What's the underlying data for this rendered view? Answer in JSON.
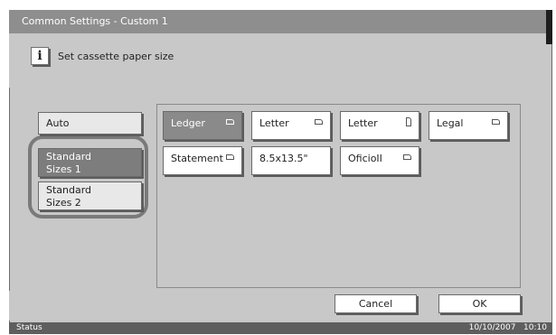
{
  "window": {
    "title": "Common Settings - Custom 1"
  },
  "info": {
    "icon": "info-icon",
    "glyph": "i",
    "message": "Set cassette paper size"
  },
  "size_modes": [
    {
      "label": "Auto",
      "selected": false
    },
    {
      "label": "Standard\nSizes 1",
      "selected": true
    },
    {
      "label": "Standard\nSizes 2",
      "selected": false
    }
  ],
  "paper_sizes": [
    {
      "label": "Ledger",
      "orientation": "landscape",
      "selected": true
    },
    {
      "label": "Letter",
      "orientation": "landscape",
      "selected": false
    },
    {
      "label": "Letter",
      "orientation": "portrait",
      "selected": false
    },
    {
      "label": "Legal",
      "orientation": "landscape",
      "selected": false
    },
    {
      "label": "Statement",
      "orientation": "landscape",
      "selected": false
    },
    {
      "label": "8.5x13.5\"",
      "orientation": "none",
      "selected": false
    },
    {
      "label": "OficioII",
      "orientation": "landscape",
      "selected": false
    }
  ],
  "actions": {
    "cancel": "Cancel",
    "ok": "OK"
  },
  "status": {
    "label": "Status",
    "datetime": "10/10/2007   10:10"
  },
  "colors": {
    "selected": "#7d7d7d",
    "panel": "#c8c8c8",
    "titlebar": "#8e8e8e",
    "statusbar": "#5e5e5e"
  }
}
